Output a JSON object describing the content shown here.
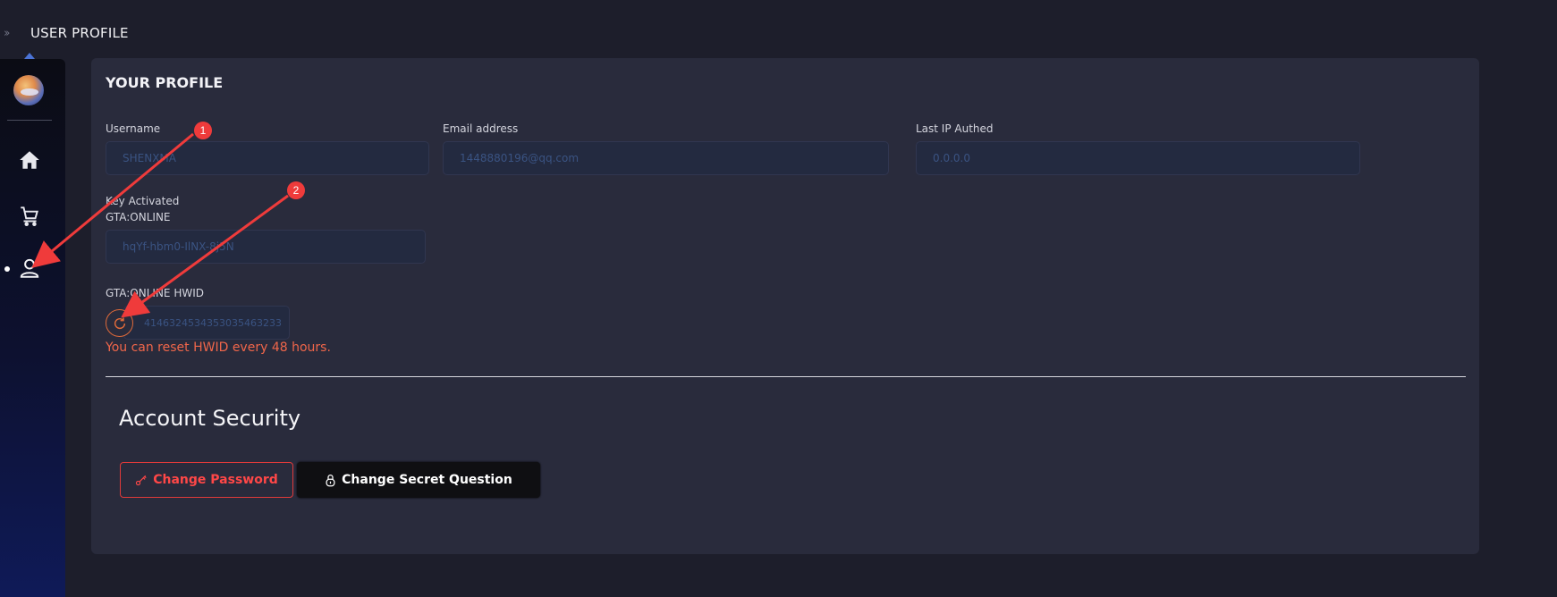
{
  "header": {
    "title": "USER PROFILE",
    "collapse_icon": "double-chevron-right-icon"
  },
  "sidebar": {
    "items": [
      {
        "name": "home",
        "icon": "home-icon"
      },
      {
        "name": "shop",
        "icon": "cart-icon"
      },
      {
        "name": "profile",
        "icon": "user-icon",
        "active": true
      }
    ]
  },
  "profile": {
    "title": "YOUR PROFILE",
    "username": {
      "label": "Username",
      "value": "SHENXMA"
    },
    "email": {
      "label": "Email address",
      "value": "1448880196@qq.com"
    },
    "last_ip": {
      "label": "Last IP Authed",
      "value": "0.0.0.0"
    },
    "key": {
      "label_line1": "Key Activated",
      "label_line2": "GTA:ONLINE",
      "value": "hqYf-hbm0-IlNX-8j5N"
    },
    "hwid": {
      "label": "GTA:ONLINE HWID",
      "value": "4146324534353035463233"
    },
    "reset_note": "You can reset HWID every 48 hours."
  },
  "security": {
    "title": "Account Security",
    "change_password": "Change Password",
    "change_secret": "Change Secret Question"
  },
  "annotations": {
    "badge1": "1",
    "badge2": "2"
  },
  "colors": {
    "accent_red": "#ff4747",
    "reset_orange": "#e06a3a",
    "annotation_red": "#ef3b3b"
  }
}
